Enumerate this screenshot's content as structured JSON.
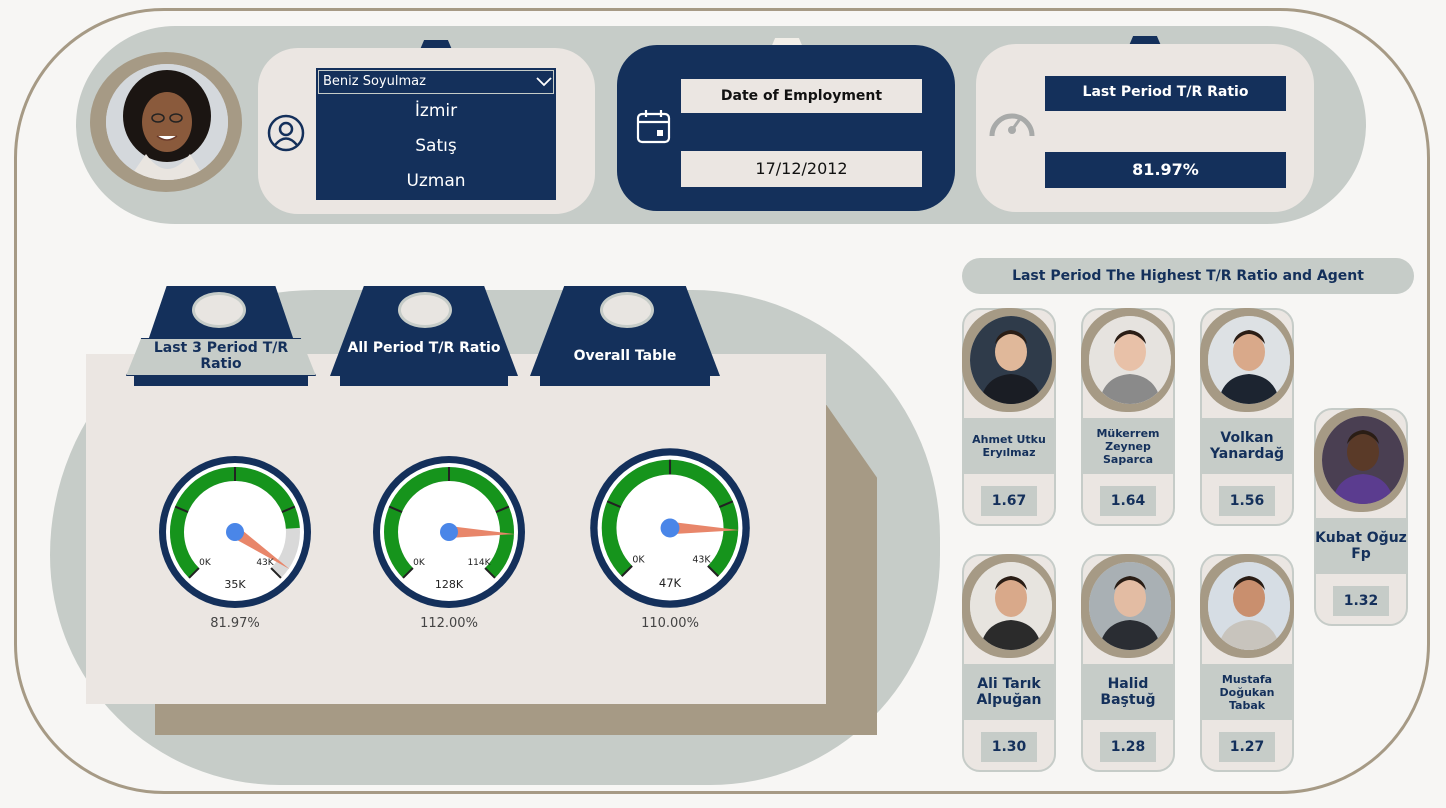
{
  "employee": {
    "selected_name": "Beniz Soyulmaz",
    "lines": [
      "İzmir",
      "Satış",
      "Uzman"
    ]
  },
  "employment": {
    "label": "Date of Employment",
    "value": "17/12/2012"
  },
  "last_period": {
    "label": "Last Period T/R Ratio",
    "value": "81.97%"
  },
  "tabs": [
    {
      "label": "Last 3 Period T/R Ratio"
    },
    {
      "label": "All Period T/R Ratio"
    },
    {
      "label": "Overall Table"
    }
  ],
  "gauges": [
    {
      "min_label": "0K",
      "max_label": "43K",
      "value_label": "35K",
      "pct": "81.97%",
      "fill": 0.8197
    },
    {
      "min_label": "0K",
      "max_label": "114K",
      "value_label": "128K",
      "pct": "112.00%",
      "fill": 1.0
    },
    {
      "min_label": "0K",
      "max_label": "43K",
      "value_label": "47K",
      "pct": "110.00%",
      "fill": 1.0
    }
  ],
  "agents_title": "Last Period The Highest T/R Ratio and Agent",
  "agents": [
    {
      "name": "Ahmet Utku Eryılmaz",
      "value": "1.67"
    },
    {
      "name": "Mükerrem Zeynep Saparca",
      "value": "1.64"
    },
    {
      "name": "Volkan Yanardağ",
      "value": "1.56"
    },
    {
      "name": "Kubat Oğuz Fp",
      "value": "1.32"
    },
    {
      "name": "Ali Tarık Alpuğan",
      "value": "1.30"
    },
    {
      "name": "Halid Baştuğ",
      "value": "1.28"
    },
    {
      "name": "Mustafa Doğukan Tabak",
      "value": "1.27"
    }
  ],
  "icons": {
    "dropdown": "chevron-down-icon",
    "user": "user-circle-icon",
    "calendar": "calendar-icon",
    "speedometer": "speedometer-icon"
  },
  "colors": {
    "navy": "#14305b",
    "sage": "#c6ccc8",
    "taupe": "#a69a85",
    "cream": "#ebe6e2",
    "gauge_green": "#16941c",
    "needle": "#e8866a",
    "hub": "#4a86e8"
  }
}
